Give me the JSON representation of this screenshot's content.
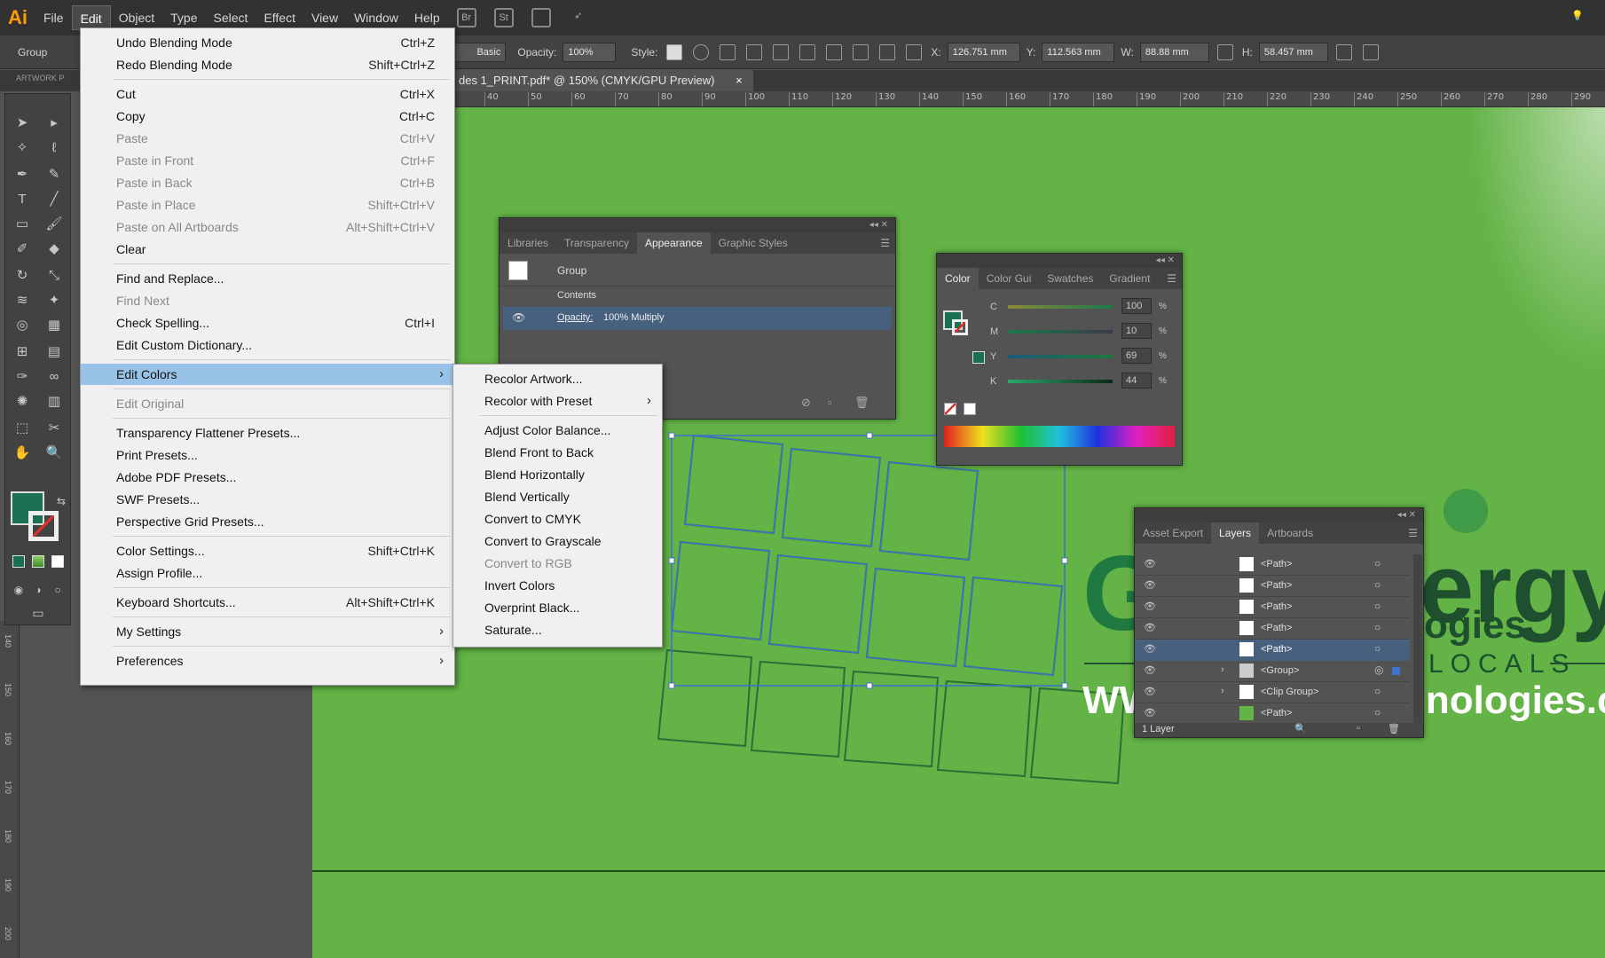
{
  "app": {
    "logo": "Ai"
  },
  "menubar": {
    "items": [
      "File",
      "Edit",
      "Object",
      "Type",
      "Select",
      "Effect",
      "View",
      "Window",
      "Help"
    ],
    "icon_labels": [
      "Br",
      "St"
    ]
  },
  "control": {
    "selection": "Group",
    "stroke_style": "Basic",
    "opacity_label": "Opacity:",
    "opacity_value": "100%",
    "style_label": "Style:",
    "x_label": "X:",
    "x_value": "126.751 mm",
    "y_label": "Y:",
    "y_value": "112.563 mm",
    "w_label": "W:",
    "w_value": "88.88 mm",
    "h_label": "H:",
    "h_value": "58.457 mm"
  },
  "document": {
    "tab_title": "des 1_PRINT.pdf* @ 150% (CMYK/GPU Preview)",
    "close": "×",
    "artboard_label": "ARTWORK P"
  },
  "ruler": {
    "h_ticks": [
      "40",
      "50",
      "60",
      "70",
      "80",
      "90",
      "100",
      "110",
      "120",
      "130",
      "140",
      "150",
      "160",
      "170",
      "180",
      "190",
      "200",
      "210",
      "220",
      "230",
      "240",
      "250",
      "260",
      "270",
      "280",
      "290"
    ],
    "v_ticks": [
      "140",
      "150",
      "160",
      "170",
      "180",
      "190",
      "200"
    ]
  },
  "edit_menu": {
    "items": [
      {
        "label": "Undo Blending Mode",
        "shortcut": "Ctrl+Z"
      },
      {
        "label": "Redo Blending Mode",
        "shortcut": "Shift+Ctrl+Z"
      },
      {
        "label": "Cut",
        "shortcut": "Ctrl+X"
      },
      {
        "label": "Copy",
        "shortcut": "Ctrl+C"
      },
      {
        "label": "Paste",
        "shortcut": "Ctrl+V"
      },
      {
        "label": "Paste in Front",
        "shortcut": "Ctrl+F"
      },
      {
        "label": "Paste in Back",
        "shortcut": "Ctrl+B"
      },
      {
        "label": "Paste in Place",
        "shortcut": "Shift+Ctrl+V"
      },
      {
        "label": "Paste on All Artboards",
        "shortcut": "Alt+Shift+Ctrl+V"
      },
      {
        "label": "Clear",
        "shortcut": ""
      },
      {
        "label": "Find and Replace...",
        "shortcut": ""
      },
      {
        "label": "Find Next",
        "shortcut": ""
      },
      {
        "label": "Check Spelling...",
        "shortcut": "Ctrl+I"
      },
      {
        "label": "Edit Custom Dictionary...",
        "shortcut": ""
      },
      {
        "label": "Edit Colors",
        "shortcut": ""
      },
      {
        "label": "Edit Original",
        "shortcut": ""
      },
      {
        "label": "Transparency Flattener Presets...",
        "shortcut": ""
      },
      {
        "label": "Print Presets...",
        "shortcut": ""
      },
      {
        "label": "Adobe PDF Presets...",
        "shortcut": ""
      },
      {
        "label": "SWF Presets...",
        "shortcut": ""
      },
      {
        "label": "Perspective Grid Presets...",
        "shortcut": ""
      },
      {
        "label": "Color Settings...",
        "shortcut": "Shift+Ctrl+K"
      },
      {
        "label": "Assign Profile...",
        "shortcut": ""
      },
      {
        "label": "Keyboard Shortcuts...",
        "shortcut": "Alt+Shift+Ctrl+K"
      },
      {
        "label": "My Settings",
        "shortcut": ""
      },
      {
        "label": "Preferences",
        "shortcut": ""
      }
    ]
  },
  "submenu": {
    "items": [
      "Recolor Artwork...",
      "Recolor with Preset",
      "Adjust Color Balance...",
      "Blend Front to Back",
      "Blend Horizontally",
      "Blend Vertically",
      "Convert to CMYK",
      "Convert to Grayscale",
      "Convert to RGB",
      "Invert Colors",
      "Overprint Black...",
      "Saturate..."
    ]
  },
  "appearance": {
    "tabs": [
      "Libraries",
      "Transparency",
      "Appearance",
      "Graphic Styles"
    ],
    "group": "Group",
    "contents": "Contents",
    "opacity_label": "Opacity:",
    "opacity_value": "100% Multiply"
  },
  "color_panel": {
    "tabs": [
      "Color",
      "Color Gui",
      "Swatches",
      "Gradient"
    ],
    "channels": [
      {
        "name": "C",
        "value": "100",
        "unit": "%"
      },
      {
        "name": "M",
        "value": "10",
        "unit": "%"
      },
      {
        "name": "Y",
        "value": "69",
        "unit": "%"
      },
      {
        "name": "K",
        "value": "44",
        "unit": "%"
      }
    ],
    "fill_color": "#1b6f52"
  },
  "layers": {
    "tabs": [
      "Asset Export",
      "Layers",
      "Artboards"
    ],
    "rows": [
      "<Path>",
      "<Path>",
      "<Path>",
      "<Path>",
      "<Path>",
      "<Group>",
      "<Clip Group>",
      "<Path>"
    ],
    "footer": "1 Layer"
  },
  "artwork": {
    "brand_left": "G",
    "brand_right": "ergy",
    "brand_sub": "ogies",
    "locals": "LOCALS",
    "www": "WW",
    "web": "hnologies.c"
  }
}
